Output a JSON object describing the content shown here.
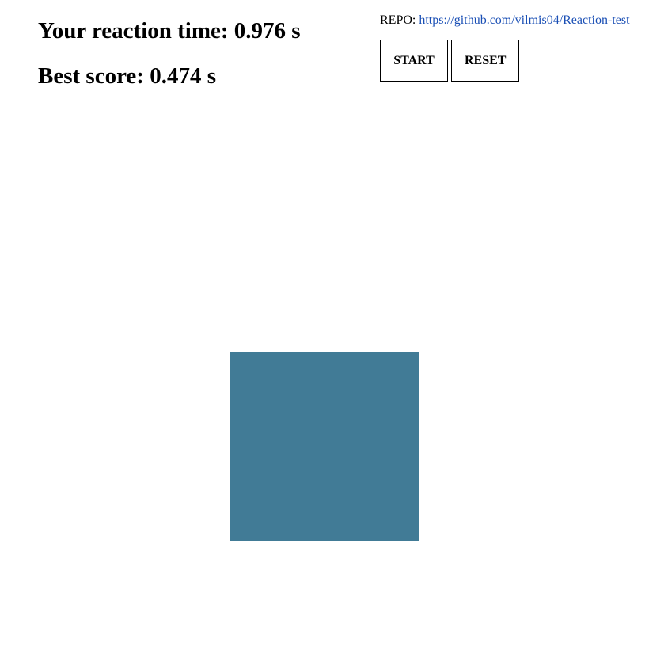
{
  "scores": {
    "reaction_label": "Your reaction time: ",
    "reaction_value": "0.976 s",
    "best_label": "Best score: ",
    "best_value": "0.474 s"
  },
  "repo": {
    "label": "REPO: ",
    "link_text": "https://github.com/vilmis04/Reaction-test"
  },
  "controls": {
    "start_label": "START",
    "reset_label": "RESET"
  },
  "target": {
    "color": "#417b96"
  }
}
